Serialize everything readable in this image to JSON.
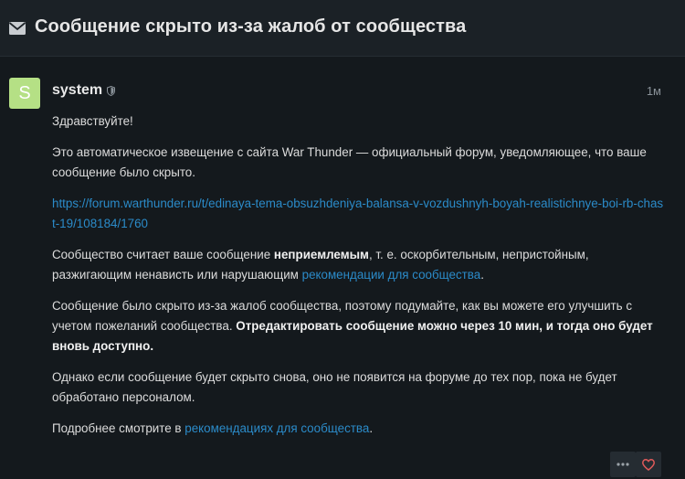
{
  "topic": {
    "title": "Сообщение скрыто из-за жалоб от сообщества",
    "icon": "envelope-icon"
  },
  "post": {
    "avatar_letter": "S",
    "avatar_color": "#b5e085",
    "username": "system",
    "date": "1м",
    "greeting": "Здравствуйте!",
    "p1": "Это автоматическое извещение с сайта War Thunder — официальный форум, уведомляющее, что ваше сообщение было скрыто.",
    "url": "https://forum.warthunder.ru/t/edinaya-tema-obsuzhdeniya-balansa-v-vozdushnyh-boyah-realistichnye-boi-rb-chast-19/108184/1760",
    "p2_a": "Сообщество считает ваше сообщение ",
    "p2_b": "неприемлемым",
    "p2_c": ", т. е. оскорбительным, непристойным, разжигающим ненависть или нарушающим ",
    "p2_link": "рекомендации для сообщества",
    "p2_d": ".",
    "p3_a": "Сообщение было скрыто из-за жалоб сообщества, поэтому подумайте, как вы можете его улучшить с учетом пожеланий сообщества. ",
    "p3_b": "Отредактировать сообщение можно через 10 мин, и тогда оно будет вновь доступно.",
    "p4": "Однако если сообщение будет скрыто снова, оно не появится на форуме до тех пор, пока не будет обработано персоналом.",
    "p5_a": "Подробнее смотрите в ",
    "p5_link": "рекомендациях для сообщества",
    "p5_b": ".",
    "link_color": "#2b8bc9"
  }
}
